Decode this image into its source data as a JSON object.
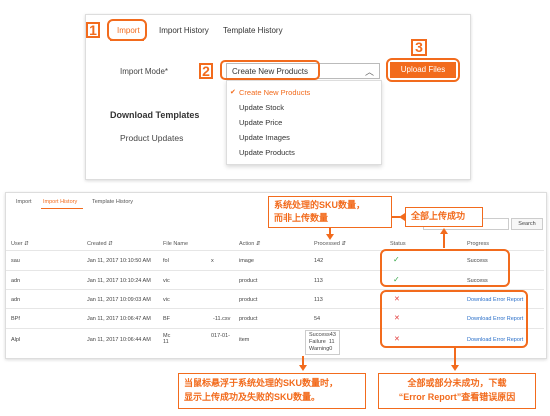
{
  "top": {
    "badges": [
      "1",
      "2",
      "3"
    ],
    "tabs": [
      "Import",
      "Import History",
      "Template History"
    ],
    "import_mode_label": "Import Mode*",
    "select_value": "Create New Products",
    "select_chevron": "chevron-up-icon",
    "upload_label": "Upload Files",
    "options": [
      "Create New Products",
      "Update Stock",
      "Update Price",
      "Update Images",
      "Update Products"
    ],
    "download_templates": "Download Templates",
    "product_updates": "Product Updates"
  },
  "bottom": {
    "tabs": [
      "Import",
      "Import History",
      "Template History"
    ],
    "search_button": "Search",
    "headers": [
      "User ⇵",
      "Created ⇵",
      "File Name",
      "Action ⇵",
      "Processed ⇵",
      "Status",
      "Progress"
    ],
    "rows": [
      {
        "user": "sau",
        "created": "Jan 11, 2017 10:10:50 AM",
        "file": "fol",
        "file2": "x",
        "action": "image",
        "processed": "142",
        "status": "ok",
        "progress": "Success"
      },
      {
        "user": "adn",
        "created": "Jan 11, 2017 10:10:24 AM",
        "file": "vic",
        "file2": "",
        "action": "product",
        "processed": "113",
        "status": "ok",
        "progress": "Success"
      },
      {
        "user": "adn",
        "created": "Jan 11, 2017 10:09:03 AM",
        "file": "vic",
        "file2": "",
        "action": "product",
        "processed": "113",
        "status": "err",
        "progress": "Download Error Report"
      },
      {
        "user": "BPf",
        "created": "Jan 11, 2017 10:06:47 AM",
        "file": "BF",
        "file2": "-11.csv",
        "action": "product",
        "processed": "54",
        "status": "err",
        "progress": "Download Error Report"
      },
      {
        "user": "Alpl",
        "created": "Jan 11, 2017 10:06:44 AM",
        "file": "Mc\n11",
        "file2": "017-01-",
        "action": "item",
        "processed": "",
        "status": "err",
        "progress": "Download Error Report"
      }
    ],
    "tooltip": "Success43\nFailure  11\nWarning0"
  },
  "callouts": {
    "processed_note": "系统处理的SKU数量，\n而非上传数量",
    "all_success": "全部上传成功",
    "hover_note": "当鼠标悬浮于系统处理的SKU数量时，\n显示上传成功及失败的SKU数量。",
    "failure_note": "全部或部分未成功，下载\n“Error Report”查看错误原因"
  },
  "colors": {
    "accent": "#f26b1d",
    "success": "#3aa84b",
    "error": "#e23a3a",
    "link": "#2a6fc9"
  }
}
